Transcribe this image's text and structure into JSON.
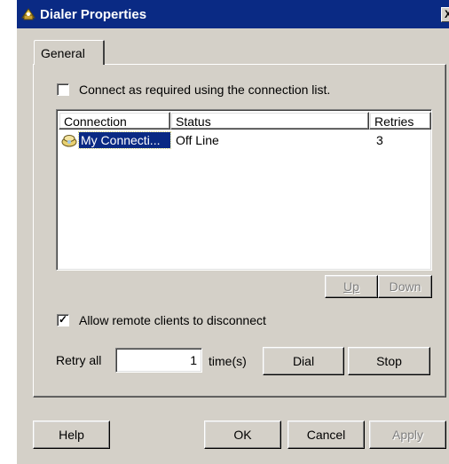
{
  "window": {
    "title": "Dialer Properties",
    "close_glyph": "X"
  },
  "tabs": [
    {
      "label": "General"
    }
  ],
  "connect_checkbox": {
    "label": "Connect as required using the connection list.",
    "checked": false
  },
  "connections": {
    "columns": [
      "Connection",
      "Status",
      "Retries"
    ],
    "rows": [
      {
        "name": "My Connecti...",
        "status": "Off Line",
        "retries": "3",
        "icon": "phone-connection-icon",
        "selected": true
      }
    ]
  },
  "list_buttons": {
    "up_label": "Up",
    "down_label": "Down"
  },
  "remote_checkbox": {
    "label": "Allow remote clients to disconnect",
    "checked": true
  },
  "retry": {
    "label": "Retry all",
    "value": "1",
    "unit": "time(s)"
  },
  "action_buttons": {
    "dial_label": "Dial",
    "stop_label": "Stop"
  },
  "footer": {
    "help_label": "Help",
    "ok_label": "OK",
    "cancel_label": "Cancel",
    "apply_label": "Apply"
  },
  "colors": {
    "face": "#d4d0c8",
    "titlebar": "#0a2a84",
    "selection": "#0a2a84"
  }
}
